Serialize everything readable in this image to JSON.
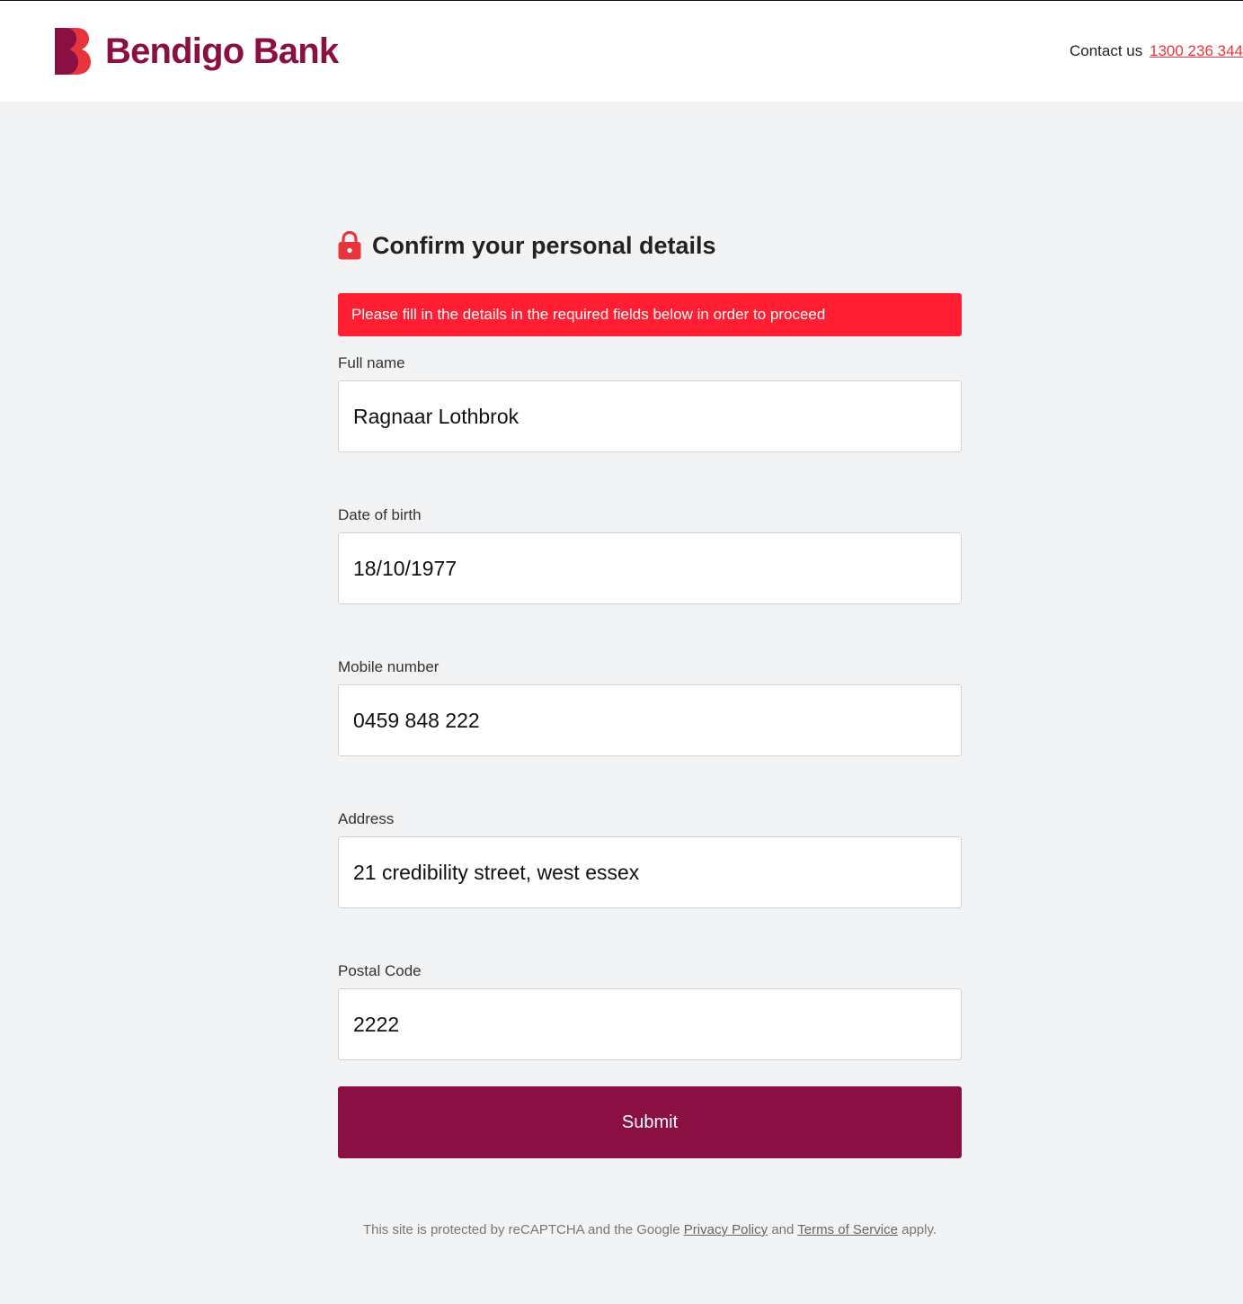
{
  "header": {
    "brand_name": "Bendigo Bank",
    "contact_label": "Contact us",
    "contact_phone": "1300 236 344"
  },
  "form": {
    "title": "Confirm your personal details",
    "alert": "Please fill in the details in the required fields below in order to proceed",
    "fields": [
      {
        "label": "Full name",
        "value": "Ragnaar Lothbrok"
      },
      {
        "label": "Date of birth",
        "value": "18/10/1977"
      },
      {
        "label": "Mobile number",
        "value": "0459 848 222"
      },
      {
        "label": "Address",
        "value": "21 credibility street, west essex"
      },
      {
        "label": "Postal Code",
        "value": "2222"
      }
    ],
    "submit_label": "Submit"
  },
  "footer": {
    "recaptcha_prefix": "This site is protected by reCAPTCHA and the Google",
    "privacy_link": "Privacy Policy",
    "and_text": "and",
    "terms_link": "Terms of Service",
    "suffix": "apply."
  },
  "colors": {
    "brand": "#8a0f42",
    "alert": "#ff1e32",
    "link": "#e8343c",
    "background": "#f2f3f5"
  },
  "icons": {
    "logo": "bendigo-b-logo-icon",
    "lock": "lock-icon"
  }
}
